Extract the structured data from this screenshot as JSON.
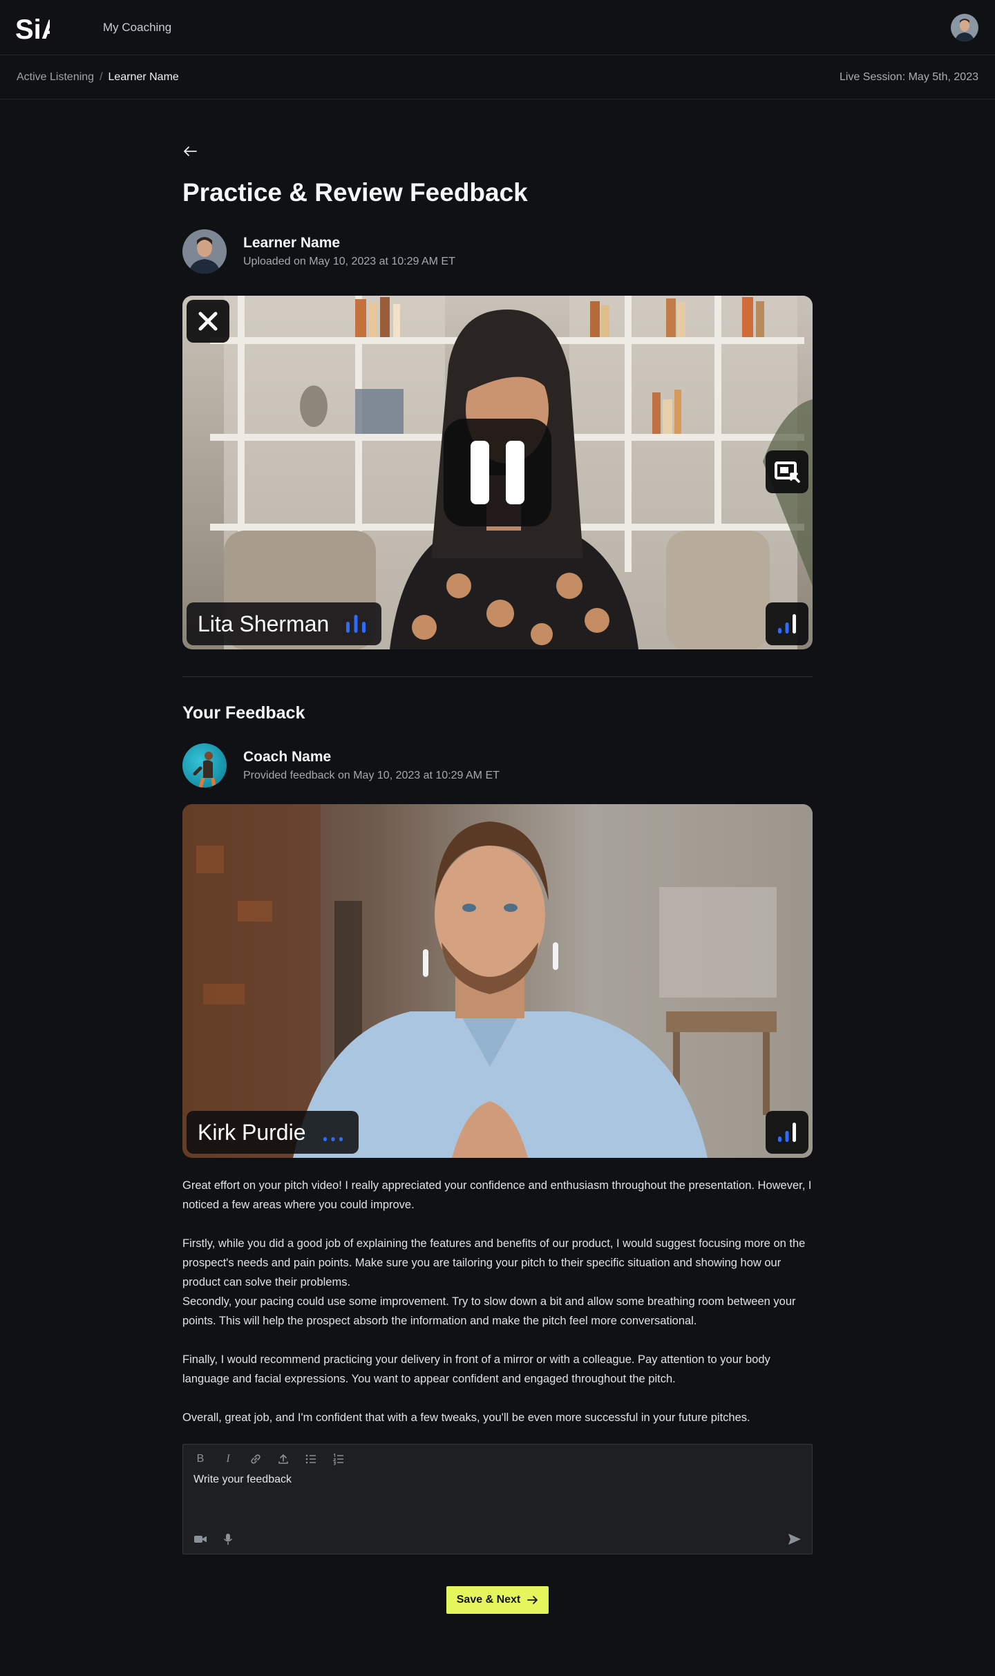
{
  "app": {
    "logo_text": "SiA",
    "nav_link": "My Coaching"
  },
  "breadcrumb": {
    "items": [
      "Active Listening",
      "Learner Name"
    ],
    "separator": "/"
  },
  "session": {
    "label": "Live Session: May 5th, 2023"
  },
  "page": {
    "title": "Practice & Review Feedback"
  },
  "learner": {
    "name": "Learner Name",
    "uploaded": "Uploaded on May 10, 2023 at 10:29 AM ET"
  },
  "learner_video": {
    "participant": "Lita Sherman",
    "state": "playing",
    "controls": [
      "close-icon",
      "pause-icon",
      "picture-in-picture-icon",
      "signal-strength-icon"
    ]
  },
  "feedback_section": {
    "title": "Your Feedback"
  },
  "coach": {
    "name": "Coach Name",
    "provided": "Provided feedback on May 10, 2023 at 10:29 AM ET"
  },
  "coach_video": {
    "participant": "Kirk Purdie"
  },
  "feedback_text": {
    "p1": "Great effort on your pitch video! I really appreciated your confidence and enthusiasm throughout the presentation. However, I noticed a few areas where you could improve.",
    "p2": "Firstly, while you did a good job of explaining the features and benefits of our product, I would suggest focusing more on the prospect's needs and pain points. Make sure you are tailoring your pitch to their specific situation and showing how our product can solve their problems.",
    "p3": "Secondly, your pacing could use some improvement. Try to slow down a bit and allow some breathing room between your points. This will help the prospect absorb the information and make the pitch feel more conversational.",
    "p4": "Finally, I would recommend practicing your delivery in front of a mirror or with a colleague. Pay attention to your body language and facial expressions. You want to appear confident and engaged throughout the pitch.",
    "p5": "Overall, great job, and I'm confident that with a few tweaks, you'll be even more successful in your future pitches."
  },
  "editor": {
    "placeholder": "Write your feedback",
    "toolbar": [
      "bold-icon",
      "italic-icon",
      "link-icon",
      "upload-icon",
      "bullet-list-icon",
      "numbered-list-icon"
    ],
    "bold_glyph": "B",
    "italic_glyph": "I"
  },
  "actions": {
    "save_next": "Save & Next"
  },
  "colors": {
    "background": "#101115",
    "accent": "#E4F65B",
    "audio_indicator": "#2F6BFF"
  }
}
